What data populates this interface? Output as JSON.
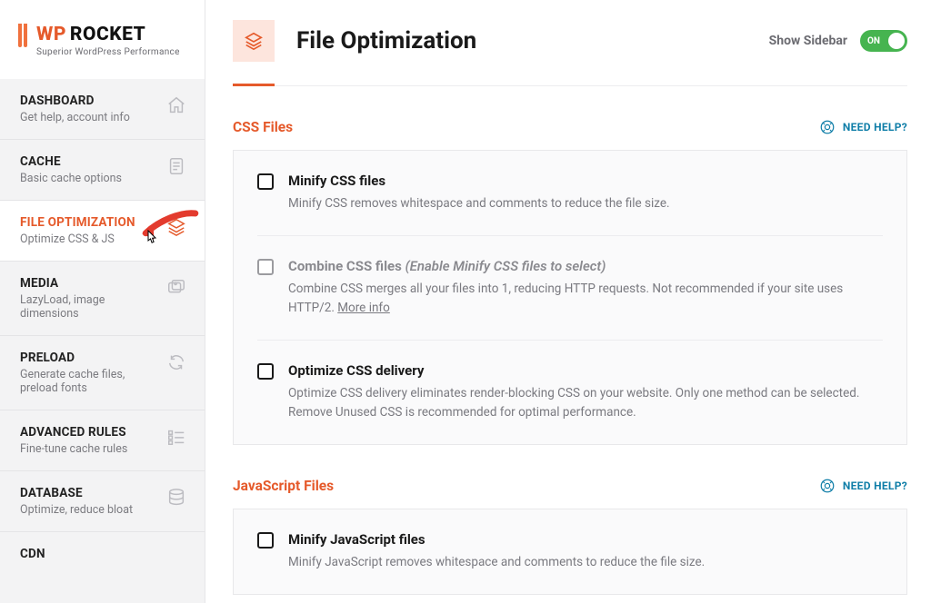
{
  "brand": {
    "wp": "WP",
    "rocket": "ROCKET",
    "tagline": "Superior WordPress Performance"
  },
  "sidebar": {
    "items": [
      {
        "title": "DASHBOARD",
        "sub": "Get help, account info"
      },
      {
        "title": "CACHE",
        "sub": "Basic cache options"
      },
      {
        "title": "FILE OPTIMIZATION",
        "sub": "Optimize CSS & JS"
      },
      {
        "title": "MEDIA",
        "sub": "LazyLoad, image dimensions"
      },
      {
        "title": "PRELOAD",
        "sub": "Generate cache files, preload fonts"
      },
      {
        "title": "ADVANCED RULES",
        "sub": "Fine-tune cache rules"
      },
      {
        "title": "DATABASE",
        "sub": "Optimize, reduce bloat"
      },
      {
        "title": "CDN",
        "sub": ""
      }
    ]
  },
  "header": {
    "title": "File Optimization",
    "show_sidebar": "Show Sidebar",
    "toggle_on": "ON"
  },
  "help": {
    "label": "NEED HELP?"
  },
  "sections": {
    "css": {
      "title": "CSS Files",
      "items": [
        {
          "title": "Minify CSS files",
          "hint": "",
          "desc": "Minify CSS removes whitespace and comments to reduce the file size."
        },
        {
          "title": "Combine CSS files ",
          "hint": "(Enable Minify CSS files to select)",
          "desc": "Combine CSS merges all your files into 1, reducing HTTP requests. Not recommended if your site uses HTTP/2. ",
          "link": "More info"
        },
        {
          "title": "Optimize CSS delivery",
          "hint": "",
          "desc": "Optimize CSS delivery eliminates render-blocking CSS on your website. Only one method can be selected. Remove Unused CSS is recommended for optimal performance."
        }
      ]
    },
    "js": {
      "title": "JavaScript Files",
      "items": [
        {
          "title": "Minify JavaScript files",
          "hint": "",
          "desc": "Minify JavaScript removes whitespace and comments to reduce the file size."
        }
      ]
    }
  }
}
